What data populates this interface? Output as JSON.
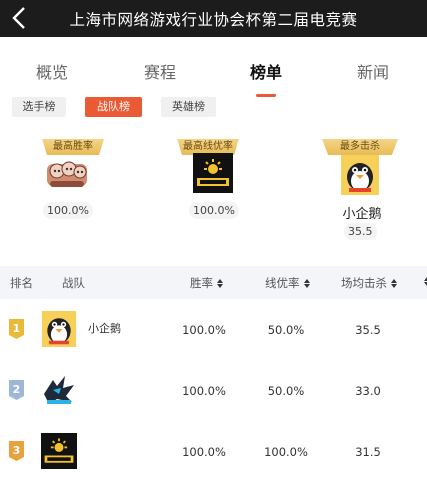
{
  "header": {
    "title": "上海市网络游戏行业协会杯第二届电竞赛"
  },
  "tabs": [
    {
      "label": "概览"
    },
    {
      "label": "赛程"
    },
    {
      "label": "榜单"
    },
    {
      "label": "新闻"
    }
  ],
  "subtabs": [
    {
      "label": "选手榜"
    },
    {
      "label": "战队榜"
    },
    {
      "label": "英雄榜"
    }
  ],
  "highlights": [
    {
      "title": "最高胜率",
      "value": "100.0%"
    },
    {
      "title": "最高线优率",
      "value": "100.0%"
    },
    {
      "title": "最多击杀",
      "team": "小企鹅",
      "value": "35.5"
    }
  ],
  "table": {
    "headers": {
      "rank": "排名",
      "team": "战队",
      "win_rate": "胜率",
      "lane_rate": "线优率",
      "kills": "场均击杀"
    },
    "rows": [
      {
        "rank": "1",
        "team": "小企鹅",
        "win_rate": "100.0%",
        "lane_rate": "50.0%",
        "kills": "35.5"
      },
      {
        "rank": "2",
        "team": "",
        "win_rate": "100.0%",
        "lane_rate": "50.0%",
        "kills": "33.0"
      },
      {
        "rank": "3",
        "team": "",
        "win_rate": "100.0%",
        "lane_rate": "100.0%",
        "kills": "31.5"
      }
    ]
  },
  "colors": {
    "accent": "#ea5a34",
    "topbar": "#1c1c1c",
    "gold": "#e7bb57"
  }
}
